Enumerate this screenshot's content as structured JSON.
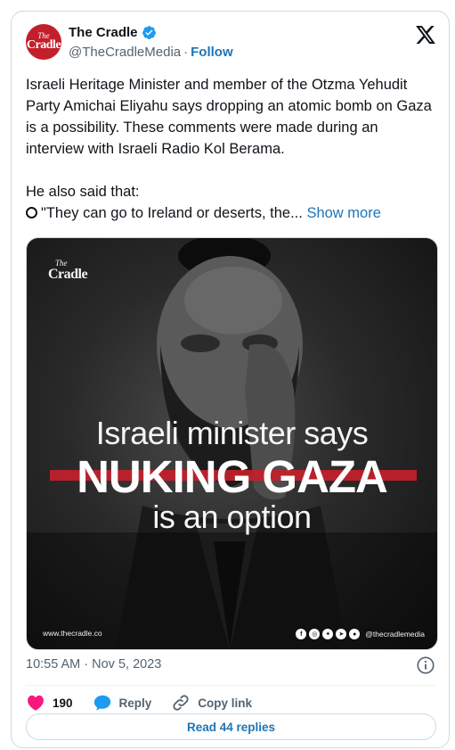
{
  "author": {
    "display_name": "The Cradle",
    "handle": "@TheCradleMedia",
    "separator": "·",
    "follow_label": "Follow",
    "avatar_the": "The",
    "avatar_name": "Cradle"
  },
  "tweet": {
    "text": "Israeli Heritage Minister and member of the Otzma Yehudit Party Amichai Eliyahu says dropping an atomic bomb on Gaza is a possibility. These comments were made during an interview with Israeli Radio Kol Berama.\n\nHe also said that:\n",
    "quote_line": "\"They can go to Ireland or deserts, the...",
    "show_more_label": "Show more"
  },
  "media": {
    "logo_the": "The",
    "logo_name": "Cradle",
    "headline_1": "Israeli minister says",
    "headline_2": "NUKING GAZA",
    "headline_3": "is an option",
    "footer_url": "www.thecradle.co",
    "footer_handle": "@thecradlemedia",
    "social_icons": [
      "facebook-icon",
      "instagram-icon",
      "twitter-icon",
      "telegram-icon",
      "patreon-icon"
    ]
  },
  "meta": {
    "timestamp": "10:55 AM · Nov 5, 2023"
  },
  "actions": {
    "like_count": "190",
    "reply_label": "Reply",
    "copy_link_label": "Copy link",
    "read_replies_label": "Read 44 replies"
  },
  "colors": {
    "accent": "#1d75b8",
    "like": "#f91880",
    "brand_red": "#c21f2b"
  }
}
